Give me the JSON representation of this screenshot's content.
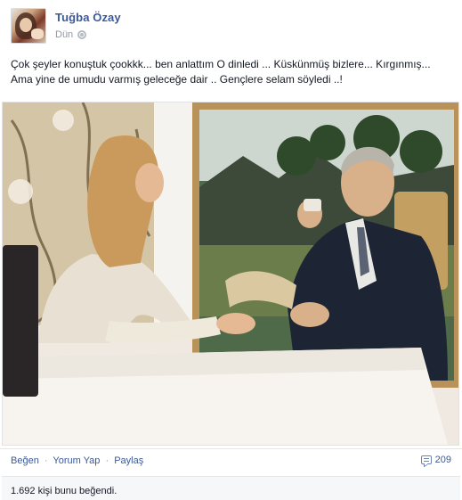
{
  "post": {
    "author": "Tuğba Özay",
    "time": "Dün",
    "privacy_icon": "globe-icon",
    "text_line1": "Çok şeyler konuştuk çookkk... ben anlattım O dinledi ... Küskünmüş bizlere... Kırgınmış...",
    "text_line2": "Ama yine de umudu varmış geleceğe dair .. Gençlere selam söyledi ..!"
  },
  "actions": {
    "like": "Beğen",
    "comment": "Yorum Yap",
    "share": "Paylaş",
    "separator": "·",
    "comment_count": "209",
    "comment_icon": "comment-icon"
  },
  "likes": {
    "summary": "1.692 kişi bunu beğendi."
  }
}
